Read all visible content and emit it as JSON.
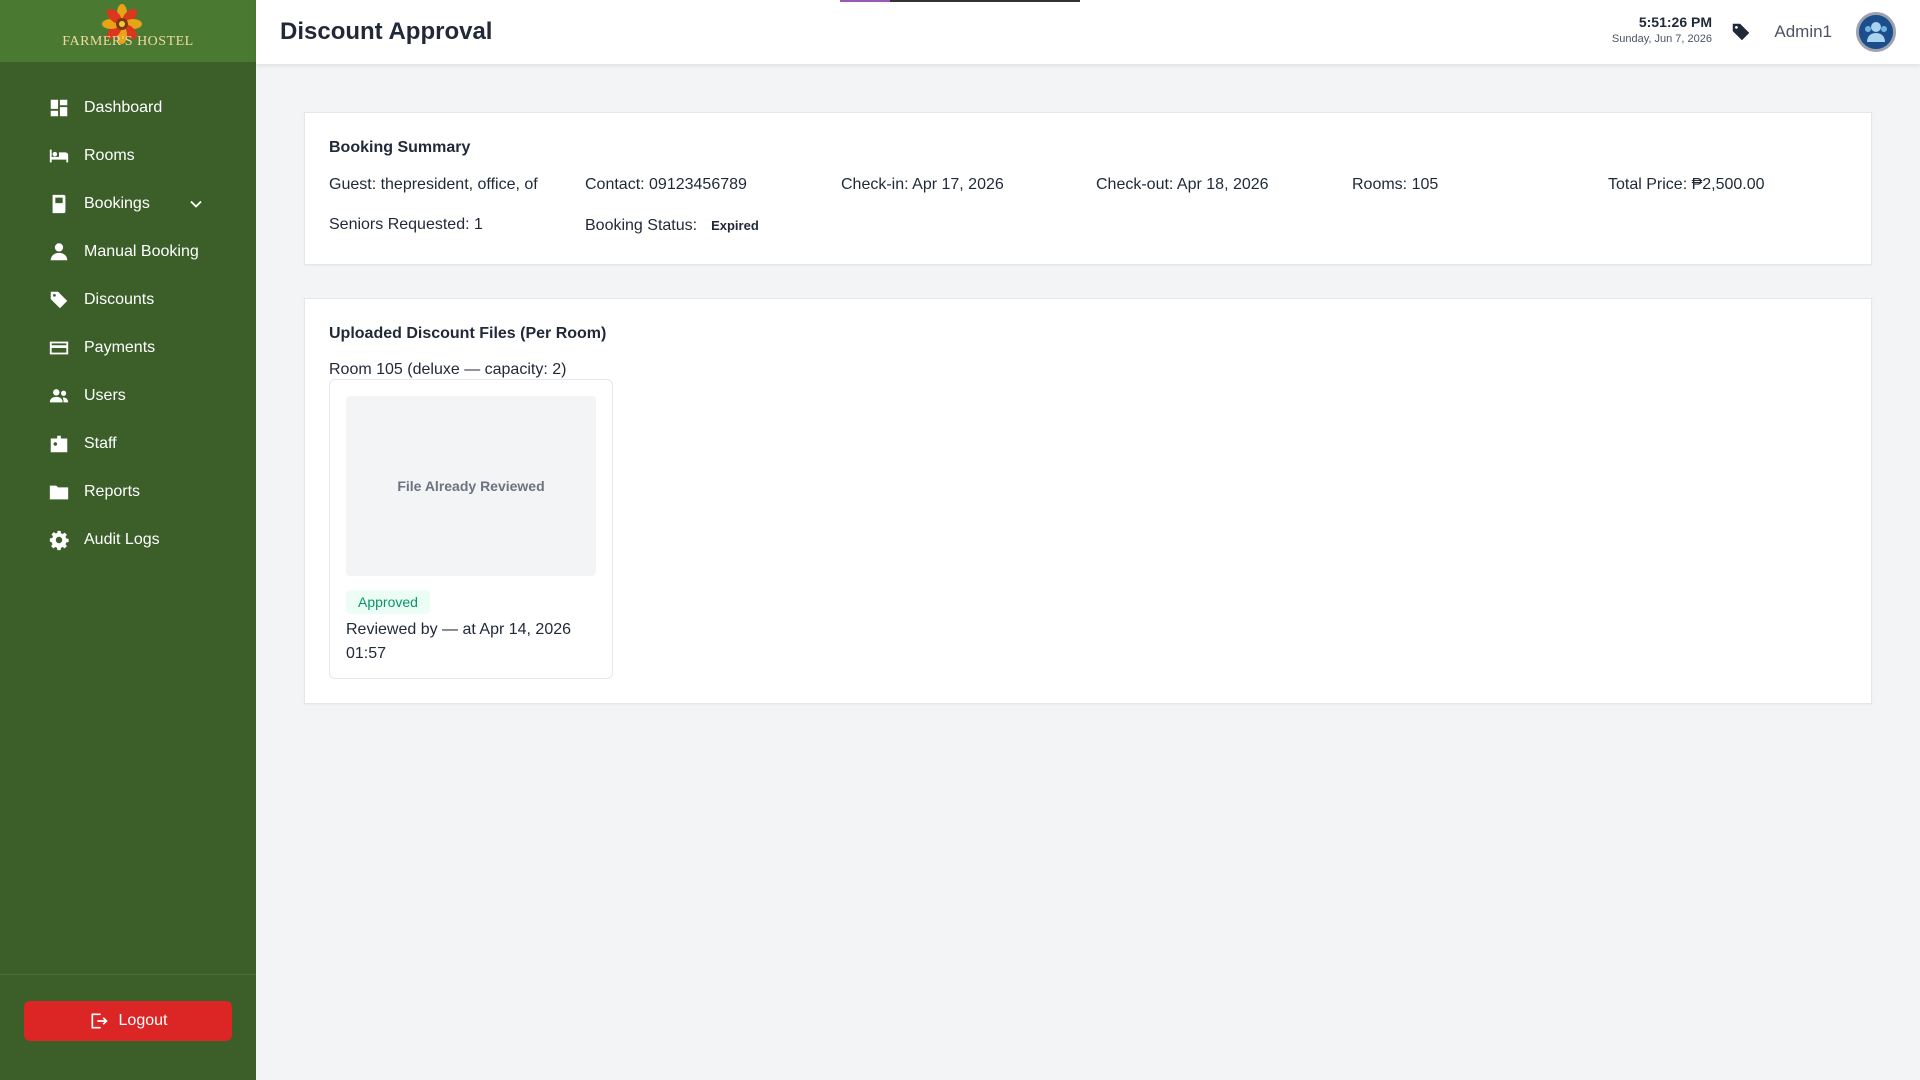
{
  "sidebar": {
    "logo_text": "FARMER'S HOSTEL",
    "items": [
      {
        "label": "Dashboard",
        "icon": "dashboard-icon"
      },
      {
        "label": "Rooms",
        "icon": "bed-icon"
      },
      {
        "label": "Bookings",
        "icon": "book-icon"
      },
      {
        "label": "Manual Booking",
        "icon": "user-icon"
      },
      {
        "label": "Discounts",
        "icon": "tag-icon"
      },
      {
        "label": "Payments",
        "icon": "credit-card-icon"
      },
      {
        "label": "Users",
        "icon": "users-icon"
      },
      {
        "label": "Staff",
        "icon": "id-badge-icon"
      },
      {
        "label": "Reports",
        "icon": "folder-icon"
      },
      {
        "label": "Audit Logs",
        "icon": "gear-icon"
      }
    ],
    "logout_label": "Logout"
  },
  "header": {
    "title": "Discount Approval",
    "time": "5:51:26 PM",
    "date": "Sunday, Jun 7, 2026",
    "user_name": "Admin1"
  },
  "summary": {
    "title": "Booking Summary",
    "guest": "Guest: thepresident, office, of",
    "contact": "Contact: 09123456789",
    "check_in": "Check-in: Apr 17, 2026",
    "check_out": "Check-out: Apr 18, 2026",
    "rooms": "Rooms: 105",
    "total_price": "Total Price: ₱2,500.00",
    "seniors": "Seniors Requested: 1",
    "status_label": "Booking Status:",
    "status_value": "Expired"
  },
  "files": {
    "title": "Uploaded Discount Files (Per Room)",
    "room_label": "Room 105 (deluxe — capacity: 2)",
    "preview_text": "File Already Reviewed",
    "badge": "Approved",
    "reviewed": "Reviewed by — at Apr 14, 2026 01:57"
  },
  "colors": {
    "sidebar_bg": "#3c5f2a",
    "logout_bg": "#dc2626",
    "approved_text": "#059669"
  }
}
